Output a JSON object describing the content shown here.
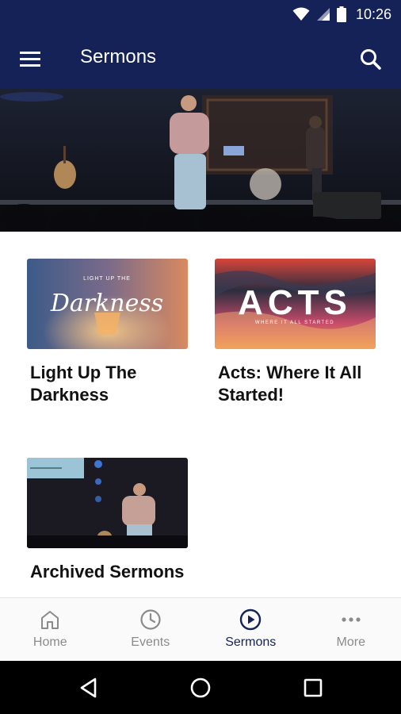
{
  "status_bar": {
    "time": "10:26",
    "icons": [
      "wifi-icon",
      "signal-icon",
      "battery-icon"
    ]
  },
  "app_bar": {
    "title": "Sermons",
    "menu_icon": "hamburger-menu-icon",
    "search_icon": "search-icon"
  },
  "colors": {
    "brand_navy": "#142257",
    "inactive_gray": "#8b8b8b"
  },
  "cards": [
    {
      "title": "Light Up The Darkness",
      "thumb_text_small": "LIGHT UP THE",
      "thumb_text_script": "Darkness"
    },
    {
      "title": "Acts: Where It All Started!",
      "thumb_text_big": "ACTS",
      "thumb_text_sub": "WHERE IT ALL STARTED"
    },
    {
      "title": "Archived Sermons"
    }
  ],
  "bottom_nav": {
    "items": [
      {
        "label": "Home",
        "icon": "home-icon",
        "active": false
      },
      {
        "label": "Events",
        "icon": "clock-icon",
        "active": false
      },
      {
        "label": "Sermons",
        "icon": "play-circle-icon",
        "active": true
      },
      {
        "label": "More",
        "icon": "more-dots-icon",
        "active": false
      }
    ]
  },
  "system_nav": {
    "icons": [
      "back-icon",
      "home-circle-icon",
      "recents-icon"
    ]
  }
}
